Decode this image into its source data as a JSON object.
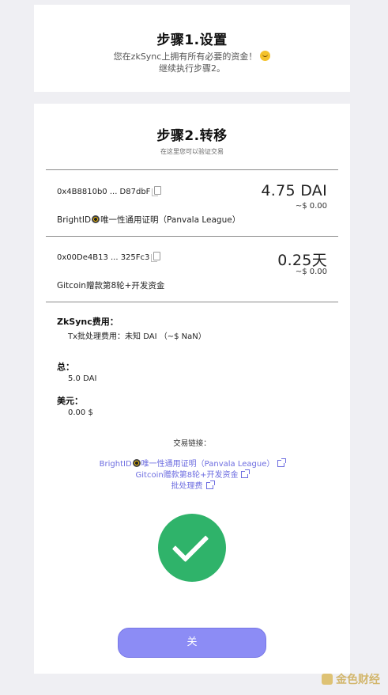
{
  "step1": {
    "title": "步骤1.设置",
    "line1": "您在zkSync上拥有所有必要的资金！",
    "line2": "继续执行步骤2。"
  },
  "step2": {
    "title": "步骤2.转移",
    "subtitle": "在这里您可以验证交易",
    "transfers": [
      {
        "address": "0x4B8810b0 ... D87dbF",
        "amount": "4.75 DAI",
        "usd": "~$ 0.00",
        "desc_a": "BrightID",
        "desc_b": "唯一性通用证明（Panvala League）"
      },
      {
        "address": "0x00De4B13 ... 325Fc3",
        "amount": "0.25天",
        "usd": "~$ 0.00",
        "desc": "Gitcoin赠款第8轮+开发资金"
      }
    ],
    "fee_label": "ZkSync费用：",
    "fee_value": "Tx批处理费用：未知 DAI （~$ NaN）",
    "total_label": "总：",
    "total_value": "5.0 DAI",
    "usd_label": "美元：",
    "usd_value": "0.00 $",
    "links_title": "交易链接：",
    "link1_a": "BrightID",
    "link1_b": "唯一性通用证明（Panvala League）",
    "link2": "Gitcoin赠款第8轮+开发资金",
    "link3": "批处理费",
    "close_label": "关"
  },
  "watermark": "金色财经",
  "icons": [
    "copy-icon",
    "external-link-icon",
    "check-icon",
    "smiley-emoji-icon",
    "sun-logo-icon"
  ],
  "colors": {
    "link": "#6d6de0",
    "success": "#2fb36a",
    "button": "#8c8cf5"
  }
}
